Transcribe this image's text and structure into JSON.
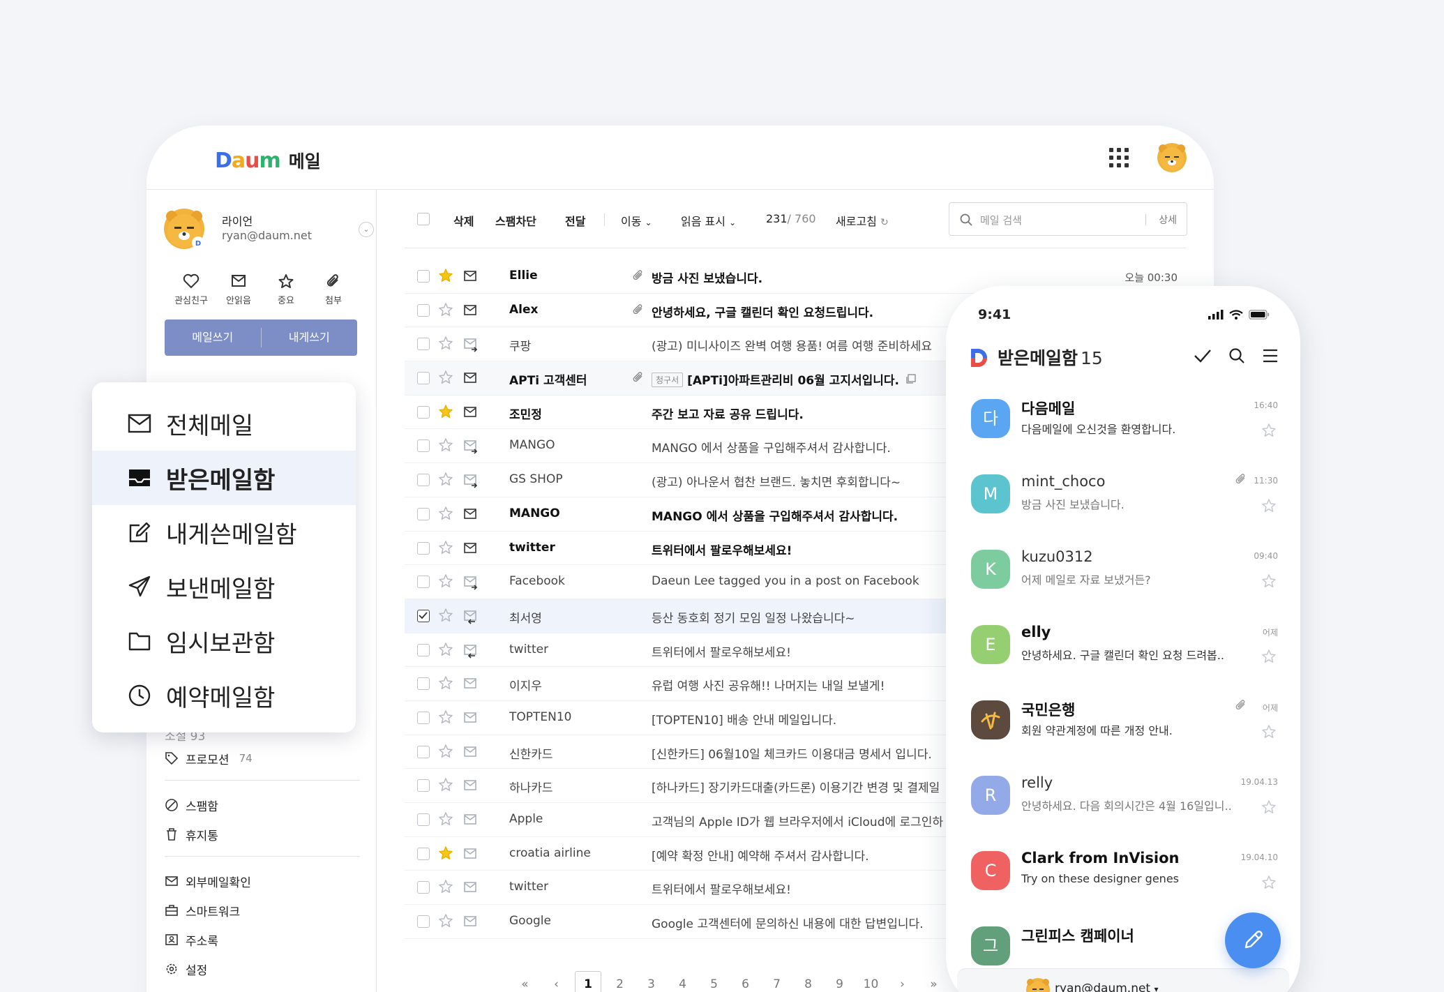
{
  "desktop": {
    "logo_word": "Daum",
    "logo_title": "메일",
    "profile": {
      "name": "라이언",
      "email": "ryan@daum.net"
    },
    "quick": [
      {
        "label": "관심친구",
        "icon": "heart-icon"
      },
      {
        "label": "안읽음",
        "icon": "envelope-icon"
      },
      {
        "label": "중요",
        "icon": "star-icon"
      },
      {
        "label": "첨부",
        "icon": "paperclip-icon"
      }
    ],
    "compose": {
      "write": "메일쓰기",
      "self": "내게쓰기"
    },
    "sidebar_partial": "소셜 93",
    "sidebar": [
      {
        "label": "프로모션",
        "count": "74",
        "icon": "tag-icon"
      },
      {
        "label": "스팸함",
        "icon": "block-icon"
      },
      {
        "label": "휴지통",
        "icon": "trash-icon"
      },
      {
        "label": "외부메일확인",
        "icon": "external-mail-icon"
      },
      {
        "label": "스마트워크",
        "icon": "briefcase-icon"
      },
      {
        "label": "주소록",
        "icon": "contacts-icon"
      },
      {
        "label": "설정",
        "icon": "gear-icon"
      }
    ],
    "toolbar": {
      "delete": "삭제",
      "spam": "스팸차단",
      "forward": "전달",
      "move": "이동",
      "read_mark": "읽음 표시",
      "count_unread": "231",
      "count_total": "/ 760",
      "refresh": "새로고침",
      "search_placeholder": "메일 검색",
      "search_detail": "상세"
    },
    "rows": [
      {
        "from": "Ellie",
        "subject": "방금 사진 보냈습니다.",
        "date": "오늘 00:30",
        "starred": true,
        "unread": true,
        "attach": true,
        "type": "mail"
      },
      {
        "from": "Alex",
        "subject": "안녕하세요, 구글 캘린더 확인 요청드립니다.",
        "date": "",
        "starred": false,
        "unread": true,
        "attach": true,
        "type": "mail"
      },
      {
        "from": "쿠팡",
        "subject": "(광고) 미니사이즈 완벽 여행 용품! 여름 여행 준비하세요",
        "date": "",
        "starred": false,
        "unread": false,
        "attach": false,
        "type": "sent"
      },
      {
        "from": "APTi 고객센터",
        "badge": "청구서",
        "subject": "[APTi]아파트관리비 06월 고지서입니다.",
        "date": "",
        "starred": false,
        "unread": true,
        "attach": true,
        "type": "mail"
      },
      {
        "from": "조민정",
        "subject": "주간 보고 자료 공유 드립니다.",
        "date": "",
        "starred": true,
        "unread": true,
        "attach": false,
        "type": "mail"
      },
      {
        "from": "MANGO",
        "subject": "MANGO 에서 상품을 구입해주셔서 감사합니다.",
        "date": "",
        "starred": false,
        "unread": false,
        "attach": false,
        "type": "sent"
      },
      {
        "from": "GS SHOP",
        "subject": "(광고) 아나운서 협찬 브랜드. 놓치면 후회합니다~",
        "date": "",
        "starred": false,
        "unread": false,
        "attach": false,
        "type": "sent"
      },
      {
        "from": "MANGO",
        "subject": "MANGO 에서 상품을 구입해주셔서 감사합니다.",
        "date": "",
        "starred": false,
        "unread": true,
        "attach": false,
        "type": "mail"
      },
      {
        "from": "twitter",
        "subject": "트위터에서 팔로우해보세요!",
        "date": "",
        "starred": false,
        "unread": true,
        "attach": false,
        "type": "mail"
      },
      {
        "from": "Facebook",
        "subject": "Daeun Lee tagged you in a post on Facebook",
        "date": "",
        "starred": false,
        "unread": false,
        "attach": false,
        "type": "sent"
      },
      {
        "from": "최서영",
        "subject": "등산 동호회 정기 모임 일정 나왔습니다~",
        "date": "",
        "starred": false,
        "unread": false,
        "attach": false,
        "type": "reply",
        "selected": true
      },
      {
        "from": "twitter",
        "subject": "트위터에서 팔로우해보세요!",
        "date": "",
        "starred": false,
        "unread": false,
        "attach": false,
        "type": "reply"
      },
      {
        "from": "이지우",
        "subject": "유럽 여행 사진 공유해!! 나머지는 내일 보낼게!",
        "date": "",
        "starred": false,
        "unread": false,
        "attach": false,
        "type": "read"
      },
      {
        "from": "TOPTEN10",
        "subject": "[TOPTEN10] 배송 안내 메일입니다.",
        "date": "",
        "starred": false,
        "unread": false,
        "attach": false,
        "type": "read"
      },
      {
        "from": "신한카드",
        "subject": "[신한카드] 06월10일 체크카드 이용대금 명세서 입니다.",
        "date": "",
        "starred": false,
        "unread": false,
        "attach": false,
        "type": "read"
      },
      {
        "from": "하나카드",
        "subject": "[하나카드] 장기카드대출(카드론) 이용기간 변경 및 결제일",
        "date": "",
        "starred": false,
        "unread": false,
        "attach": false,
        "type": "read"
      },
      {
        "from": "Apple",
        "subject": "고객님의 Apple ID가 웹 브라우저에서 iCloud에 로그인하",
        "date": "",
        "starred": false,
        "unread": false,
        "attach": false,
        "type": "read"
      },
      {
        "from": "croatia airline",
        "subject": "[예약 확정 안내] 예약해 주셔서 감사합니다.",
        "date": "",
        "starred": true,
        "unread": false,
        "attach": false,
        "type": "read"
      },
      {
        "from": "twitter",
        "subject": "트위터에서 팔로우해보세요!",
        "date": "",
        "starred": false,
        "unread": false,
        "attach": false,
        "type": "read"
      },
      {
        "from": "Google",
        "subject": "Google 고객센터에 문의하신 내용에 대한 답변입니다.",
        "date": "",
        "starred": false,
        "unread": false,
        "attach": false,
        "type": "read"
      }
    ],
    "pager": [
      "1",
      "2",
      "3",
      "4",
      "5",
      "6",
      "7",
      "8",
      "9",
      "10"
    ],
    "pager_current": "1"
  },
  "folders": [
    {
      "label": "전체메일",
      "icon": "envelope-icon"
    },
    {
      "label": "받은메일함",
      "icon": "inbox-icon",
      "active": true
    },
    {
      "label": "내게쓴메일함",
      "icon": "edit-icon"
    },
    {
      "label": "보낸메일함",
      "icon": "send-icon"
    },
    {
      "label": "임시보관함",
      "icon": "folder-icon"
    },
    {
      "label": "예약메일함",
      "icon": "clock-icon"
    }
  ],
  "phone": {
    "time": "9:41",
    "title": "받은메일함",
    "count": "15",
    "items": [
      {
        "avatar": "다",
        "color": "#5ba6f2",
        "name": "다음메일",
        "preview": "다음메일에 오신것을 환영합니다.",
        "time": "16:40",
        "bold": true,
        "clip": false
      },
      {
        "avatar": "M",
        "color": "#5bc4cf",
        "name": "mint_choco",
        "preview": "방금 사진 보냈습니다.",
        "time": "11:30",
        "bold": false,
        "clip": true
      },
      {
        "avatar": "K",
        "color": "#7ccc9f",
        "name": "kuzu0312",
        "preview": "어제 메일로 자료 보냈거든?",
        "time": "09:40",
        "bold": false,
        "clip": false
      },
      {
        "avatar": "E",
        "color": "#95cf72",
        "name": "elly",
        "preview": "안녕하세요. 구글 캘린더 확인 요청 드려봅..",
        "time": "어제",
        "bold": true,
        "clip": false
      },
      {
        "avatar": "",
        "color": "#5c4a3f",
        "name": "국민은행",
        "preview": "회원 약관계정에 따른 개정 안내.",
        "time": "어제",
        "bold": true,
        "clip": true
      },
      {
        "avatar": "R",
        "color": "#93a9e8",
        "name": "relly",
        "preview": "안녕하세요. 다음 회의시간은 4월 16일입니..",
        "time": "19.04.13",
        "bold": false,
        "clip": false
      },
      {
        "avatar": "C",
        "color": "#f06262",
        "name": "Clark from InVision",
        "preview": "Try on these designer genes",
        "time": "19.04.10",
        "bold": true,
        "clip": false
      },
      {
        "avatar": "그",
        "color": "#62a07c",
        "name": "그린피스 캠페이너",
        "preview": "",
        "time": "",
        "bold": true,
        "clip": false
      }
    ],
    "account": "ryan@daum.net"
  }
}
